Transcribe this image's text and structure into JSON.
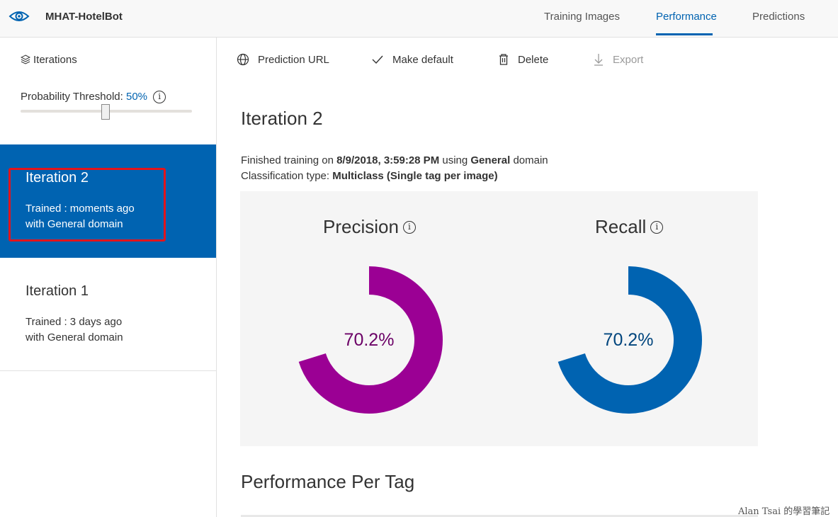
{
  "app": {
    "name": "MHAT-HotelBot"
  },
  "nav": {
    "tabs": [
      "Training Images",
      "Performance",
      "Predictions"
    ],
    "active": "Performance"
  },
  "sidebar": {
    "iterations_label": "Iterations",
    "threshold_label": "Probability Threshold:",
    "threshold_value": "50%",
    "threshold_fraction": 0.5,
    "iterations": [
      {
        "name": "Iteration 2",
        "trained": "Trained : moments ago",
        "domain": "with General domain",
        "selected": true
      },
      {
        "name": "Iteration 1",
        "trained": "Trained : 3 days ago",
        "domain": "with General domain",
        "selected": false
      }
    ]
  },
  "toolbar": {
    "prediction_url": "Prediction URL",
    "make_default": "Make default",
    "delete": "Delete",
    "export": "Export"
  },
  "main": {
    "title": "Iteration 2",
    "finished_prefix": "Finished training on",
    "finished_date": "8/9/2018, 3:59:28 PM",
    "using": "using",
    "domain": "General",
    "domain_suffix": "domain",
    "class_prefix": "Classification type:",
    "class_value": "Multiclass (Single tag per image)",
    "precision": {
      "label": "Precision",
      "value_text": "70.2%",
      "value": 70.2,
      "color": "#9b0094"
    },
    "recall": {
      "label": "Recall",
      "value_text": "70.2%",
      "value": 70.2,
      "color": "#0063b1"
    },
    "per_tag_title": "Performance Per Tag"
  },
  "watermark": "Alan Tsai 的學習筆記",
  "colors": {
    "accent": "#0063b1",
    "highlight": "#e3141c"
  }
}
